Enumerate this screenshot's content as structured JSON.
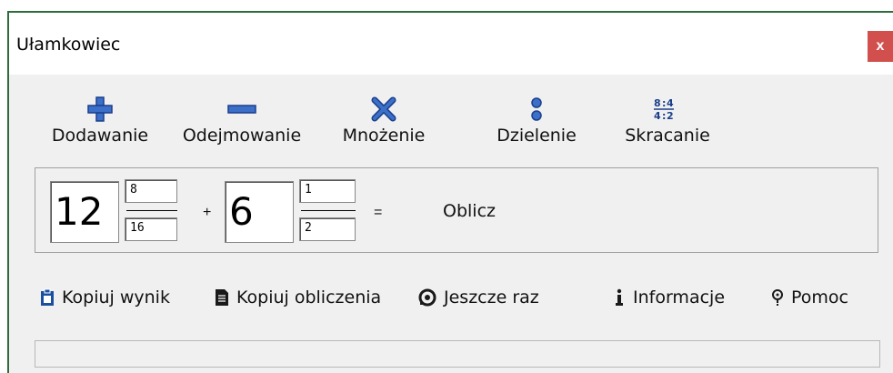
{
  "window": {
    "title": "Ułamkowiec",
    "close_label": "x"
  },
  "toolbar": {
    "add": {
      "label": "Dodawanie",
      "icon": "plus-icon"
    },
    "subtract": {
      "label": "Odejmowanie",
      "icon": "minus-icon"
    },
    "multiply": {
      "label": "Mnożenie",
      "icon": "multiply-icon"
    },
    "divide": {
      "label": "Dzielenie",
      "icon": "divide-icon"
    },
    "reduce": {
      "label": "Skracanie",
      "icon": "reduce-fraction-icon"
    }
  },
  "calculator": {
    "fraction1": {
      "whole": "12",
      "numerator": "8",
      "denominator": "16"
    },
    "operator": "+",
    "fraction2": {
      "whole": "6",
      "numerator": "1",
      "denominator": "2"
    },
    "equals": "=",
    "compute_label": "Oblicz"
  },
  "actions": {
    "copy_result": "Kopiuj wynik",
    "copy_calculations": "Kopiuj obliczenia",
    "again": "Jeszcze raz",
    "info": "Informacje",
    "help": "Pomoc"
  },
  "colors": {
    "accent": "#1a4fa0",
    "close_bg": "#d1504e",
    "frame": "#2e6b3d"
  }
}
